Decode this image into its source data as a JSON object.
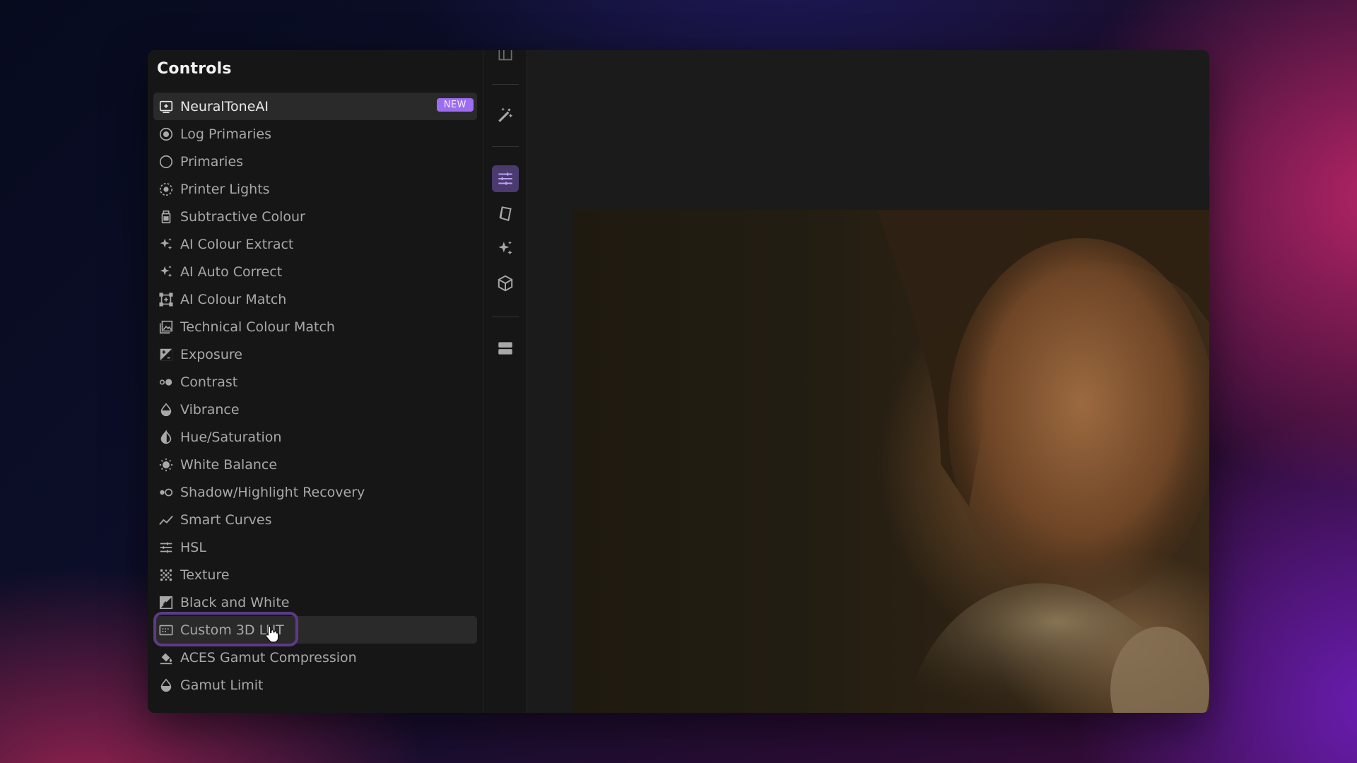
{
  "sidebar": {
    "title": "Controls",
    "items": [
      {
        "label": "NeuralToneAI",
        "icon": "neural-tone-icon",
        "badge": "NEW"
      },
      {
        "label": "Log Primaries",
        "icon": "target-circle-icon"
      },
      {
        "label": "Primaries",
        "icon": "circle-icon"
      },
      {
        "label": "Printer Lights",
        "icon": "dotted-circle-icon"
      },
      {
        "label": "Subtractive Colour",
        "icon": "ink-bottle-icon"
      },
      {
        "label": "AI Colour Extract",
        "icon": "sparkle-icon"
      },
      {
        "label": "AI Auto Correct",
        "icon": "sparkle-icon"
      },
      {
        "label": "AI Colour Match",
        "icon": "frame-match-icon"
      },
      {
        "label": "Technical Colour Match",
        "icon": "image-gallery-icon"
      },
      {
        "label": "Exposure",
        "icon": "exposure-icon"
      },
      {
        "label": "Contrast",
        "icon": "contrast-dots-icon"
      },
      {
        "label": "Vibrance",
        "icon": "droplet-icon"
      },
      {
        "label": "Hue/Saturation",
        "icon": "half-droplet-icon"
      },
      {
        "label": "White Balance",
        "icon": "sun-icon"
      },
      {
        "label": "Shadow/Highlight Recovery",
        "icon": "shadow-highlight-icon"
      },
      {
        "label": "Smart Curves",
        "icon": "curve-icon"
      },
      {
        "label": "HSL",
        "icon": "sliders-icon"
      },
      {
        "label": "Texture",
        "icon": "texture-dots-icon"
      },
      {
        "label": "Black and White",
        "icon": "bw-icon"
      },
      {
        "label": "Custom 3D LUT",
        "icon": "lut-icon"
      },
      {
        "label": "ACES Gamut Compression",
        "icon": "fill-bucket-icon"
      },
      {
        "label": "Gamut Limit",
        "icon": "droplet-icon"
      }
    ]
  },
  "toolbar": {
    "tools": [
      "magic-wand-icon",
      "adjustments-icon",
      "shape-icon",
      "sparkle-icon",
      "cube-icon",
      "layers-icon"
    ],
    "active": "adjustments-icon"
  },
  "colors": {
    "accent": "#9d6cf0",
    "badge_bg": "#9d6cf0",
    "focus_ring": "#5d3a88",
    "panel_bg": "#161616"
  }
}
